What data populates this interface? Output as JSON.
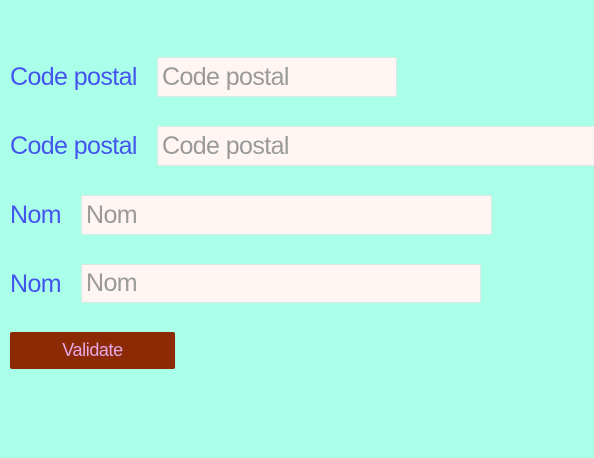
{
  "form": {
    "rows": [
      {
        "label": "Code postal",
        "placeholder": "Code postal"
      },
      {
        "label": "Code postal",
        "placeholder": "Code postal"
      },
      {
        "label": "Nom",
        "placeholder": "Nom"
      },
      {
        "label": "Nom",
        "placeholder": "Nom"
      }
    ],
    "submit_label": "Validate"
  }
}
